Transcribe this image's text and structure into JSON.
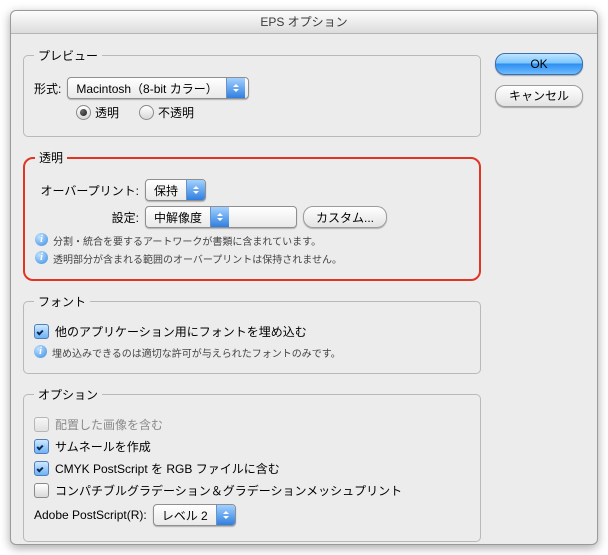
{
  "window_title": "EPS オプション",
  "buttons": {
    "ok": "OK",
    "cancel": "キャンセル"
  },
  "preview": {
    "legend": "プレビュー",
    "format_label": "形式:",
    "format_value": "Macintosh（8-bit カラー）",
    "radio_transparent": "透明",
    "radio_opaque": "不透明"
  },
  "transparency": {
    "legend": "透明",
    "overprint_label": "オーバープリント:",
    "overprint_value": "保持",
    "preset_label": "設定:",
    "preset_value": "中解像度",
    "custom_btn": "カスタム...",
    "info1": "分割・統合を要するアートワークが書類に含まれています。",
    "info2": "透明部分が含まれる範囲のオーバープリントは保持されません。"
  },
  "font": {
    "legend": "フォント",
    "embed_label": "他のアプリケーション用にフォントを埋め込む",
    "info": "埋め込みできるのは適切な許可が与えられたフォントのみです。"
  },
  "options": {
    "legend": "オプション",
    "include_placed": "配置した画像を含む",
    "thumbnail": "サムネールを作成",
    "cmyk_rgb": "CMYK PostScript を RGB ファイルに含む",
    "compat_grad": "コンパチブルグラデーション＆グラデーションメッシュプリント",
    "ps_label": "Adobe PostScript(R):",
    "ps_value": "レベル 2"
  }
}
